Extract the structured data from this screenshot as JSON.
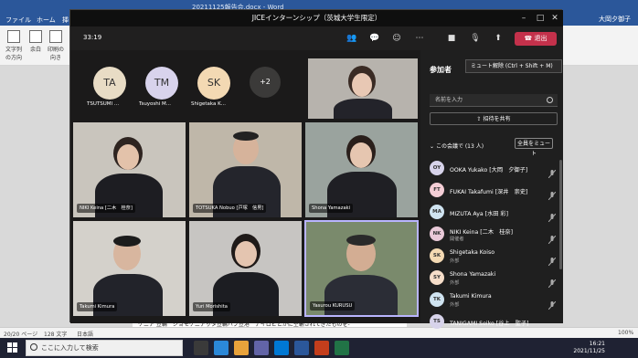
{
  "word": {
    "title": "20211125報告会.docx - Word",
    "user": "大岡夕御子",
    "share": "共有",
    "tabs": [
      "ファイル",
      "ホーム",
      "挿入"
    ],
    "ribbon": [
      "文字列の方向",
      "余白",
      "印刷の向き"
    ],
    "status": {
      "page": "20/20 ページ",
      "words": "128 文字",
      "lang": "日本語",
      "zoom": "100%"
    },
    "doc_line": "ケニア 笠輪　ジョモケニアッタ笠輪ハブ笠港　ナイロビとがに空輸されてきたものを-"
  },
  "taskbar": {
    "search_placeholder": "ここに入力して検索",
    "time": "16:21",
    "date": "2021/11/25"
  },
  "teams": {
    "window_title": "JICEインターンシップ（茨城大学生限定）",
    "timer": "33:19",
    "leave_label": "退出",
    "tooltip": "ミュート解除 (Ctrl + Shift + M)",
    "avatars": [
      {
        "initials": "TA",
        "name": "TSUTSUMI ...",
        "color": "#e8dcc5"
      },
      {
        "initials": "TM",
        "name": "Tsuyoshi M...",
        "color": "#d8d3ec"
      },
      {
        "initials": "SK",
        "name": "Shigetaka K...",
        "color": "#f3d9b3"
      }
    ],
    "more_count": "+2",
    "tiles": [
      {
        "name": "NIKI Keina [二木　桂奈]"
      },
      {
        "name": "TOTSUKA Nobuo [戸塚　信男]"
      },
      {
        "name": "Shona Yamazaki"
      },
      {
        "name": "Takumi Kimura"
      },
      {
        "name": "Yuri Morishita"
      },
      {
        "name": "Yasurou KURUSU"
      }
    ],
    "panel": {
      "title": "参加者",
      "search_placeholder": "名前を入力",
      "share_invite": "招待を共有",
      "in_meeting": "この会議で (13 人)",
      "mute_all": "全員をミュート",
      "participants": [
        {
          "initials": "OY",
          "name": "OOKA Yukako [大岡　夕御子]",
          "role": "",
          "color": "#d7d3ea"
        },
        {
          "initials": "FT",
          "name": "FUKAI Takafumi [深井　崇史]",
          "role": "",
          "color": "#f3cdd5"
        },
        {
          "initials": "MA",
          "name": "MIZUTA Aya [水田 彩]",
          "role": "",
          "color": "#cfe3f0"
        },
        {
          "initials": "NK",
          "name": "NIKI Keina [二木　桂奈]",
          "role": "開催者",
          "color": "#e9c9d8"
        },
        {
          "initials": "SK",
          "name": "Shigetaka Koiso",
          "role": "外部",
          "color": "#f3d9b3"
        },
        {
          "initials": "SY",
          "name": "Shona Yamazaki",
          "role": "外部",
          "color": "#f6ddc9"
        },
        {
          "initials": "TK",
          "name": "Takumi Kimura",
          "role": "外部",
          "color": "#cfe3f0"
        },
        {
          "initials": "TS",
          "name": "TANIGAMI Seiko [谷上　聖子]",
          "role": "",
          "color": "#d7d3ea"
        }
      ]
    }
  }
}
